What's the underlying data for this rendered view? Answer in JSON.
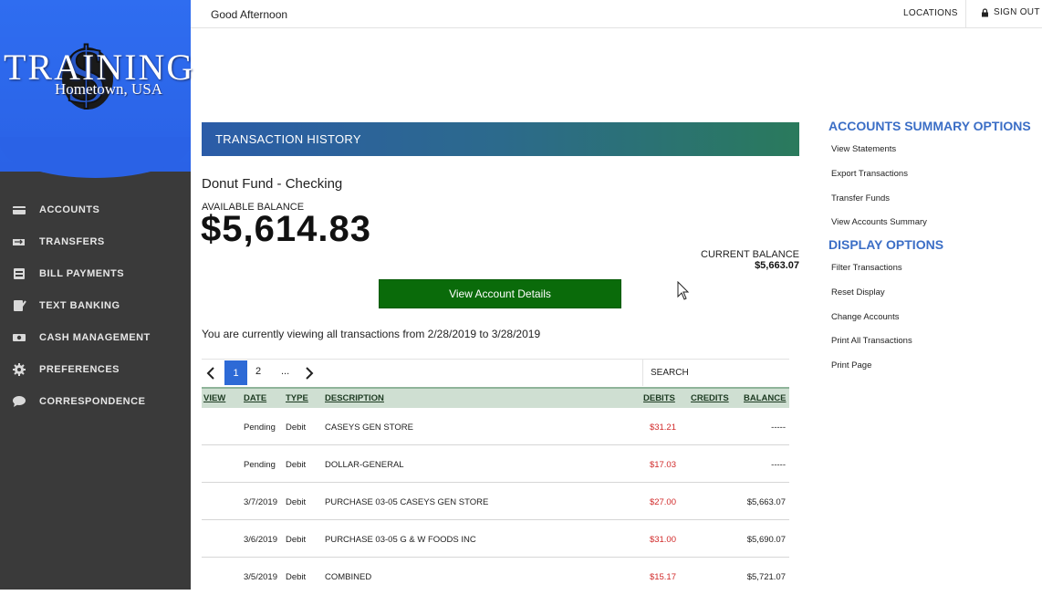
{
  "brand": {
    "title": "TRAINING",
    "subtitle": "Hometown, USA",
    "colors": {
      "primary": "#2a62e6",
      "sidebar": "#3a3a3a"
    }
  },
  "nav": [
    {
      "label": "ACCOUNTS",
      "icon": "accounts-icon"
    },
    {
      "label": "TRANSFERS",
      "icon": "transfers-icon"
    },
    {
      "label": "BILL PAYMENTS",
      "icon": "bill-payments-icon"
    },
    {
      "label": "TEXT BANKING",
      "icon": "text-banking-icon"
    },
    {
      "label": "CASH MANAGEMENT",
      "icon": "cash-management-icon"
    },
    {
      "label": "PREFERENCES",
      "icon": "gear-icon"
    },
    {
      "label": "CORRESPONDENCE",
      "icon": "chat-bubble-icon"
    }
  ],
  "topbar": {
    "greeting": "Good Afternoon",
    "locations": "LOCATIONS",
    "signout": "SIGN OUT"
  },
  "main": {
    "section_title": "TRANSACTION HISTORY",
    "account_name": "Donut Fund - Checking",
    "available_label": "AVAILABLE BALANCE",
    "available_amount": "$5,614.83",
    "current_label": "CURRENT BALANCE",
    "current_amount": "$5,663.07",
    "view_button": "View Account Details",
    "viewing_text": "You are currently viewing all transactions from 2/28/2019 to 3/28/2019",
    "pager": {
      "page1": "1",
      "page2": "2",
      "dots": "...",
      "search": "SEARCH"
    },
    "columns": {
      "view": "VIEW",
      "date": "DATE",
      "type": "TYPE",
      "description": "DESCRIPTION",
      "debits": "DEBITS",
      "credits": "CREDITS",
      "balance": "BALANCE"
    },
    "rows": [
      {
        "date": "Pending",
        "type": "Debit",
        "description": "CASEYS GEN STORE",
        "debit": "$31.21",
        "credit": "",
        "balance": "-----"
      },
      {
        "date": "Pending",
        "type": "Debit",
        "description": "DOLLAR-GENERAL",
        "debit": "$17.03",
        "credit": "",
        "balance": "-----"
      },
      {
        "date": "3/7/2019",
        "type": "Debit",
        "description": "PURCHASE 03-05 CASEYS GEN STORE",
        "debit": "$27.00",
        "credit": "",
        "balance": "$5,663.07"
      },
      {
        "date": "3/6/2019",
        "type": "Debit",
        "description": "PURCHASE 03-05 G & W FOODS INC",
        "debit": "$31.00",
        "credit": "",
        "balance": "$5,690.07"
      },
      {
        "date": "3/5/2019",
        "type": "Debit",
        "description": "COMBINED",
        "debit": "$15.17",
        "credit": "",
        "balance": "$5,721.07"
      }
    ]
  },
  "options": {
    "accounts_heading": "ACCOUNTS SUMMARY OPTIONS",
    "accounts_items": [
      "View Statements",
      "Export Transactions",
      "Transfer Funds",
      "View Accounts Summary"
    ],
    "display_heading": "DISPLAY OPTIONS",
    "display_items": [
      "Filter Transactions",
      "Reset Display",
      "Change Accounts",
      "Print All Transactions",
      "Print Page"
    ]
  }
}
